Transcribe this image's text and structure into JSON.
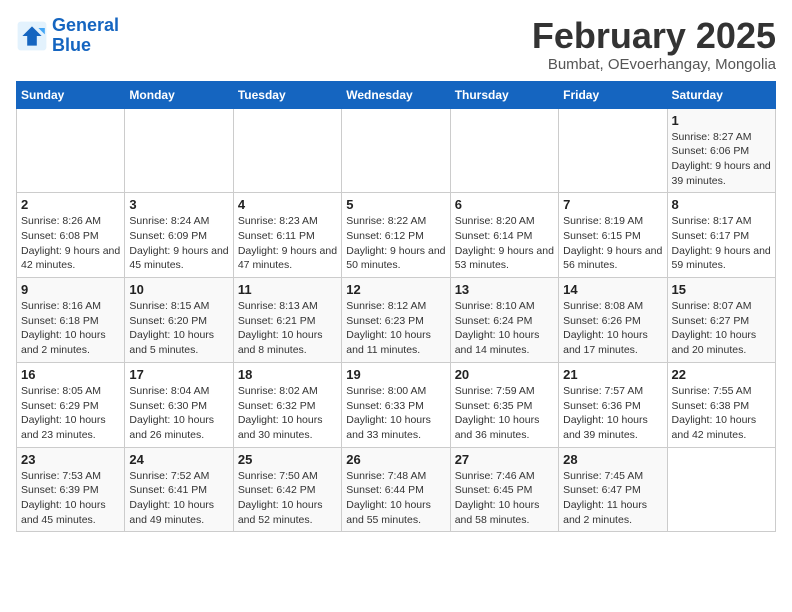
{
  "header": {
    "logo_line1": "General",
    "logo_line2": "Blue",
    "title": "February 2025",
    "subtitle": "Bumbat, OEvoerhangay, Mongolia"
  },
  "days_of_week": [
    "Sunday",
    "Monday",
    "Tuesday",
    "Wednesday",
    "Thursday",
    "Friday",
    "Saturday"
  ],
  "weeks": [
    [
      {
        "day": "",
        "info": ""
      },
      {
        "day": "",
        "info": ""
      },
      {
        "day": "",
        "info": ""
      },
      {
        "day": "",
        "info": ""
      },
      {
        "day": "",
        "info": ""
      },
      {
        "day": "",
        "info": ""
      },
      {
        "day": "1",
        "info": "Sunrise: 8:27 AM\nSunset: 6:06 PM\nDaylight: 9 hours and 39 minutes."
      }
    ],
    [
      {
        "day": "2",
        "info": "Sunrise: 8:26 AM\nSunset: 6:08 PM\nDaylight: 9 hours and 42 minutes."
      },
      {
        "day": "3",
        "info": "Sunrise: 8:24 AM\nSunset: 6:09 PM\nDaylight: 9 hours and 45 minutes."
      },
      {
        "day": "4",
        "info": "Sunrise: 8:23 AM\nSunset: 6:11 PM\nDaylight: 9 hours and 47 minutes."
      },
      {
        "day": "5",
        "info": "Sunrise: 8:22 AM\nSunset: 6:12 PM\nDaylight: 9 hours and 50 minutes."
      },
      {
        "day": "6",
        "info": "Sunrise: 8:20 AM\nSunset: 6:14 PM\nDaylight: 9 hours and 53 minutes."
      },
      {
        "day": "7",
        "info": "Sunrise: 8:19 AM\nSunset: 6:15 PM\nDaylight: 9 hours and 56 minutes."
      },
      {
        "day": "8",
        "info": "Sunrise: 8:17 AM\nSunset: 6:17 PM\nDaylight: 9 hours and 59 minutes."
      }
    ],
    [
      {
        "day": "9",
        "info": "Sunrise: 8:16 AM\nSunset: 6:18 PM\nDaylight: 10 hours and 2 minutes."
      },
      {
        "day": "10",
        "info": "Sunrise: 8:15 AM\nSunset: 6:20 PM\nDaylight: 10 hours and 5 minutes."
      },
      {
        "day": "11",
        "info": "Sunrise: 8:13 AM\nSunset: 6:21 PM\nDaylight: 10 hours and 8 minutes."
      },
      {
        "day": "12",
        "info": "Sunrise: 8:12 AM\nSunset: 6:23 PM\nDaylight: 10 hours and 11 minutes."
      },
      {
        "day": "13",
        "info": "Sunrise: 8:10 AM\nSunset: 6:24 PM\nDaylight: 10 hours and 14 minutes."
      },
      {
        "day": "14",
        "info": "Sunrise: 8:08 AM\nSunset: 6:26 PM\nDaylight: 10 hours and 17 minutes."
      },
      {
        "day": "15",
        "info": "Sunrise: 8:07 AM\nSunset: 6:27 PM\nDaylight: 10 hours and 20 minutes."
      }
    ],
    [
      {
        "day": "16",
        "info": "Sunrise: 8:05 AM\nSunset: 6:29 PM\nDaylight: 10 hours and 23 minutes."
      },
      {
        "day": "17",
        "info": "Sunrise: 8:04 AM\nSunset: 6:30 PM\nDaylight: 10 hours and 26 minutes."
      },
      {
        "day": "18",
        "info": "Sunrise: 8:02 AM\nSunset: 6:32 PM\nDaylight: 10 hours and 30 minutes."
      },
      {
        "day": "19",
        "info": "Sunrise: 8:00 AM\nSunset: 6:33 PM\nDaylight: 10 hours and 33 minutes."
      },
      {
        "day": "20",
        "info": "Sunrise: 7:59 AM\nSunset: 6:35 PM\nDaylight: 10 hours and 36 minutes."
      },
      {
        "day": "21",
        "info": "Sunrise: 7:57 AM\nSunset: 6:36 PM\nDaylight: 10 hours and 39 minutes."
      },
      {
        "day": "22",
        "info": "Sunrise: 7:55 AM\nSunset: 6:38 PM\nDaylight: 10 hours and 42 minutes."
      }
    ],
    [
      {
        "day": "23",
        "info": "Sunrise: 7:53 AM\nSunset: 6:39 PM\nDaylight: 10 hours and 45 minutes."
      },
      {
        "day": "24",
        "info": "Sunrise: 7:52 AM\nSunset: 6:41 PM\nDaylight: 10 hours and 49 minutes."
      },
      {
        "day": "25",
        "info": "Sunrise: 7:50 AM\nSunset: 6:42 PM\nDaylight: 10 hours and 52 minutes."
      },
      {
        "day": "26",
        "info": "Sunrise: 7:48 AM\nSunset: 6:44 PM\nDaylight: 10 hours and 55 minutes."
      },
      {
        "day": "27",
        "info": "Sunrise: 7:46 AM\nSunset: 6:45 PM\nDaylight: 10 hours and 58 minutes."
      },
      {
        "day": "28",
        "info": "Sunrise: 7:45 AM\nSunset: 6:47 PM\nDaylight: 11 hours and 2 minutes."
      },
      {
        "day": "",
        "info": ""
      }
    ]
  ]
}
